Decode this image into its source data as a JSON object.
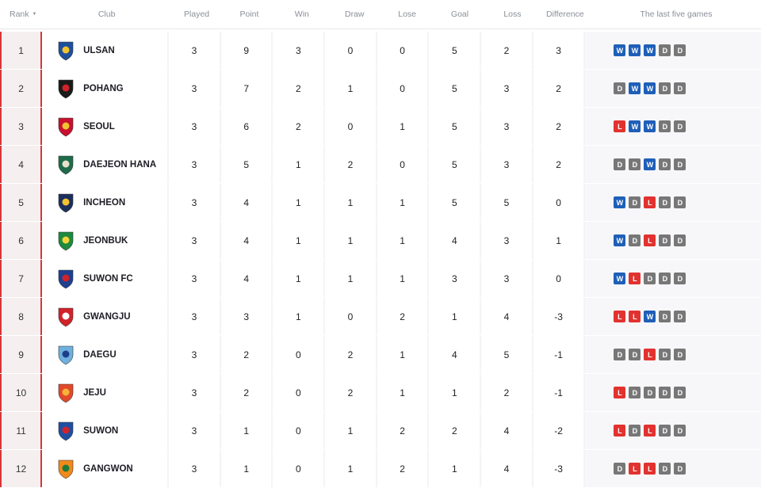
{
  "headers": {
    "rank": "Rank",
    "club": "Club",
    "played": "Played",
    "point": "Point",
    "win": "Win",
    "draw": "Draw",
    "lose": "Lose",
    "goal": "Goal",
    "loss": "Loss",
    "difference": "Difference",
    "last_five": "The last five games"
  },
  "sort_icon": "caret-down-icon",
  "colors": {
    "win": "#1f5fb8",
    "draw": "#777777",
    "loss": "#e2322f",
    "rank_bar": "#d9353a"
  },
  "rows": [
    {
      "rank": "1",
      "club": "ULSAN",
      "played": "3",
      "point": "9",
      "win": "3",
      "draw": "0",
      "lose": "0",
      "goal": "5",
      "loss": "2",
      "diff": "3",
      "last5": [
        "W",
        "W",
        "W",
        "D",
        "D"
      ],
      "logo_color": "#1d4f9c",
      "logo_accent": "#f2c230"
    },
    {
      "rank": "2",
      "club": "POHANG",
      "played": "3",
      "point": "7",
      "win": "2",
      "draw": "1",
      "lose": "0",
      "goal": "5",
      "loss": "3",
      "diff": "2",
      "last5": [
        "D",
        "W",
        "W",
        "D",
        "D"
      ],
      "logo_color": "#1a1a1a",
      "logo_accent": "#d1232a"
    },
    {
      "rank": "3",
      "club": "SEOUL",
      "played": "3",
      "point": "6",
      "win": "2",
      "draw": "0",
      "lose": "1",
      "goal": "5",
      "loss": "3",
      "diff": "2",
      "last5": [
        "L",
        "W",
        "W",
        "D",
        "D"
      ],
      "logo_color": "#c8102e",
      "logo_accent": "#f2c230"
    },
    {
      "rank": "4",
      "club": "DAEJEON HANA",
      "played": "3",
      "point": "5",
      "win": "1",
      "draw": "2",
      "lose": "0",
      "goal": "5",
      "loss": "3",
      "diff": "2",
      "last5": [
        "D",
        "D",
        "W",
        "D",
        "D"
      ],
      "logo_color": "#1e6b4a",
      "logo_accent": "#e7e2c9"
    },
    {
      "rank": "5",
      "club": "INCHEON",
      "played": "3",
      "point": "4",
      "win": "1",
      "draw": "1",
      "lose": "1",
      "goal": "5",
      "loss": "5",
      "diff": "0",
      "last5": [
        "W",
        "D",
        "L",
        "D",
        "D"
      ],
      "logo_color": "#1c2f5c",
      "logo_accent": "#f2c230"
    },
    {
      "rank": "6",
      "club": "JEONBUK",
      "played": "3",
      "point": "4",
      "win": "1",
      "draw": "1",
      "lose": "1",
      "goal": "4",
      "loss": "3",
      "diff": "1",
      "last5": [
        "W",
        "D",
        "L",
        "D",
        "D"
      ],
      "logo_color": "#1d8a3e",
      "logo_accent": "#f5d33b"
    },
    {
      "rank": "7",
      "club": "SUWON FC",
      "played": "3",
      "point": "4",
      "win": "1",
      "draw": "1",
      "lose": "1",
      "goal": "3",
      "loss": "3",
      "diff": "0",
      "last5": [
        "W",
        "L",
        "D",
        "D",
        "D"
      ],
      "logo_color": "#1f3f8f",
      "logo_accent": "#d1232a"
    },
    {
      "rank": "8",
      "club": "GWANGJU",
      "played": "3",
      "point": "3",
      "win": "1",
      "draw": "0",
      "lose": "2",
      "goal": "1",
      "loss": "4",
      "diff": "-3",
      "last5": [
        "L",
        "L",
        "W",
        "D",
        "D"
      ],
      "logo_color": "#d1232a",
      "logo_accent": "#ffffff"
    },
    {
      "rank": "9",
      "club": "DAEGU",
      "played": "3",
      "point": "2",
      "win": "0",
      "draw": "2",
      "lose": "1",
      "goal": "4",
      "loss": "5",
      "diff": "-1",
      "last5": [
        "D",
        "D",
        "L",
        "D",
        "D"
      ],
      "logo_color": "#6fb0dd",
      "logo_accent": "#1c3f8a"
    },
    {
      "rank": "10",
      "club": "JEJU",
      "played": "3",
      "point": "2",
      "win": "0",
      "draw": "2",
      "lose": "1",
      "goal": "1",
      "loss": "2",
      "diff": "-1",
      "last5": [
        "L",
        "D",
        "D",
        "D",
        "D"
      ],
      "logo_color": "#e2492b",
      "logo_accent": "#f6b33a"
    },
    {
      "rank": "11",
      "club": "SUWON",
      "played": "3",
      "point": "1",
      "win": "0",
      "draw": "1",
      "lose": "2",
      "goal": "2",
      "loss": "4",
      "diff": "-2",
      "last5": [
        "L",
        "D",
        "L",
        "D",
        "D"
      ],
      "logo_color": "#1f4fa0",
      "logo_accent": "#d1232a"
    },
    {
      "rank": "12",
      "club": "GANGWON",
      "played": "3",
      "point": "1",
      "win": "0",
      "draw": "1",
      "lose": "2",
      "goal": "1",
      "loss": "4",
      "diff": "-3",
      "last5": [
        "D",
        "L",
        "L",
        "D",
        "D"
      ],
      "logo_color": "#f08a1c",
      "logo_accent": "#1d7a3a"
    }
  ]
}
